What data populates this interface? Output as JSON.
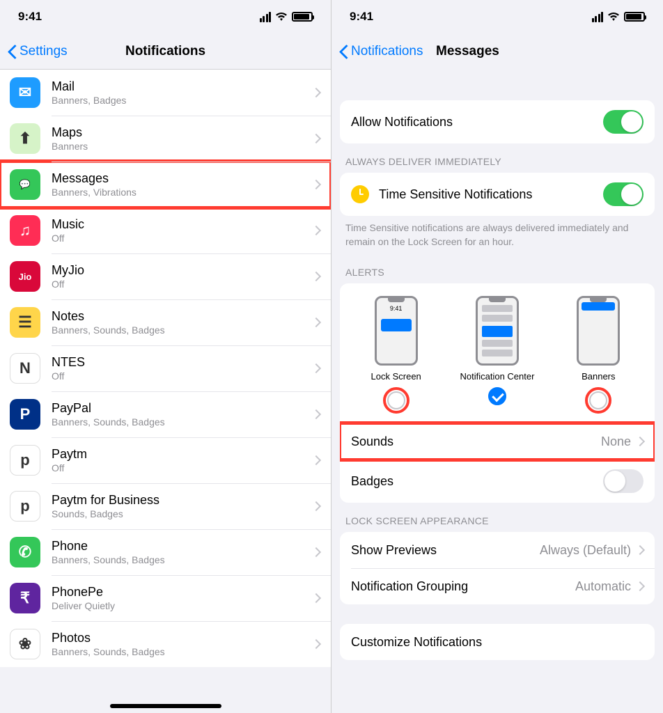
{
  "status": {
    "time": "9:41"
  },
  "left": {
    "back": "Settings",
    "title": "Notifications",
    "apps": [
      {
        "name": "Mail",
        "sub": "Banners, Badges",
        "bg": "#1e9cff",
        "letter": "✉"
      },
      {
        "name": "Maps",
        "sub": "Banners",
        "bg": "#d6f3c8",
        "letter": "⬆"
      },
      {
        "name": "Messages",
        "sub": "Banners, Vibrations",
        "bg": "#34c759",
        "letter": "💬",
        "highlight": true
      },
      {
        "name": "Music",
        "sub": "Off",
        "bg": "#ff2d55",
        "letter": "♫"
      },
      {
        "name": "MyJio",
        "sub": "Off",
        "bg": "#d9083a",
        "letter": "Jio"
      },
      {
        "name": "Notes",
        "sub": "Banners, Sounds, Badges",
        "bg": "#ffd54a",
        "letter": "☰"
      },
      {
        "name": "NTES",
        "sub": "Off",
        "bg": "#ffffff",
        "letter": "N"
      },
      {
        "name": "PayPal",
        "sub": "Banners, Sounds, Badges",
        "bg": "#003087",
        "letter": "P"
      },
      {
        "name": "Paytm",
        "sub": "Off",
        "bg": "#ffffff",
        "letter": "p"
      },
      {
        "name": "Paytm for Business",
        "sub": "Sounds, Badges",
        "bg": "#ffffff",
        "letter": "p"
      },
      {
        "name": "Phone",
        "sub": "Banners, Sounds, Badges",
        "bg": "#34c759",
        "letter": "✆"
      },
      {
        "name": "PhonePe",
        "sub": "Deliver Quietly",
        "bg": "#5f259f",
        "letter": "₹"
      },
      {
        "name": "Photos",
        "sub": "Banners, Sounds, Badges",
        "bg": "#ffffff",
        "letter": "❀"
      }
    ]
  },
  "right": {
    "back": "Notifications",
    "title": "Messages",
    "allow": "Allow Notifications",
    "deliver_header": "ALWAYS DELIVER IMMEDIATELY",
    "time_sensitive": "Time Sensitive Notifications",
    "ts_footer": "Time Sensitive notifications are always delivered immediately and remain on the Lock Screen for an hour.",
    "alerts_header": "ALERTS",
    "alerts": {
      "lock": "Lock Screen",
      "nc": "Notification Center",
      "banners": "Banners",
      "preview_time": "9:41"
    },
    "sounds": "Sounds",
    "sounds_value": "None",
    "badges": "Badges",
    "lsa_header": "LOCK SCREEN APPEARANCE",
    "previews": "Show Previews",
    "previews_value": "Always (Default)",
    "grouping": "Notification Grouping",
    "grouping_value": "Automatic",
    "customize": "Customize Notifications"
  }
}
